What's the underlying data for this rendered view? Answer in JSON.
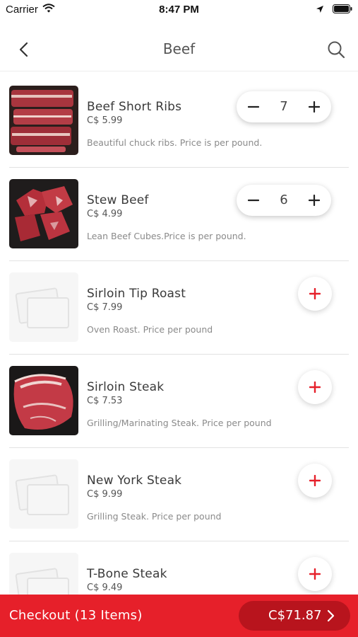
{
  "status_bar": {
    "carrier": "Carrier",
    "time": "8:47 PM"
  },
  "nav": {
    "title": "Beef",
    "back_icon": "chevron-left-icon",
    "search_icon": "search-icon"
  },
  "colors": {
    "accent": "#e6202a",
    "accent_dark": "#b8141d"
  },
  "products": [
    {
      "name": "Beef Short Ribs",
      "price": "C$ 5.99",
      "description": "Beautiful chuck ribs. Price is per pound.",
      "image": "beef-short-ribs-photo",
      "quantity": "7"
    },
    {
      "name": "Stew Beef",
      "price": "C$ 4.99",
      "description": "Lean Beef Cubes.Price is per pound.",
      "image": "stew-beef-photo",
      "quantity": "6"
    },
    {
      "name": "Sirloin Tip Roast",
      "price": "C$ 7.99",
      "description": "Oven Roast. Price per pound",
      "image": "placeholder-image-icon",
      "quantity": null
    },
    {
      "name": "Sirloin Steak",
      "price": "C$ 7.53",
      "description": "Grilling/Marinating Steak. Price per pound",
      "image": "sirloin-steak-photo",
      "quantity": null
    },
    {
      "name": "New York Steak",
      "price": "C$ 9.99",
      "description": "Grilling Steak. Price per pound",
      "image": "placeholder-image-icon",
      "quantity": null
    },
    {
      "name": "T-Bone Steak",
      "price": "C$ 9.49",
      "description": "",
      "image": "placeholder-image-icon",
      "quantity": null
    }
  ],
  "checkout": {
    "label": "Checkout (13 Items)",
    "total": "C$71.87"
  }
}
